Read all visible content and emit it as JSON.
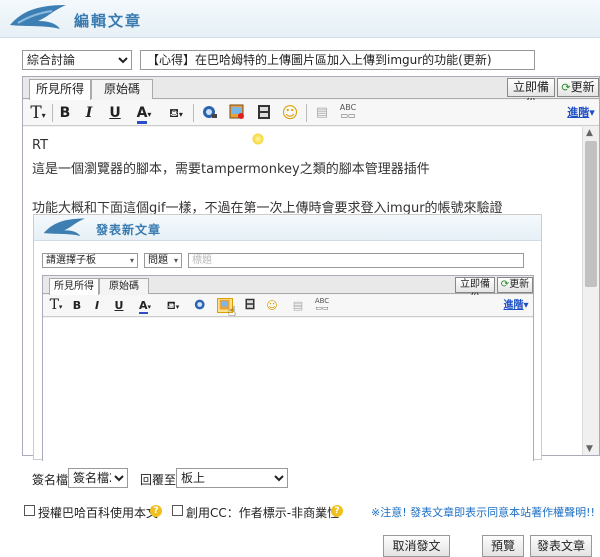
{
  "header": {
    "title": "編輯文章"
  },
  "form": {
    "category": "綜合討論",
    "title_value": "【心得】在巴哈姆特的上傳圖片區加入上傳到imgur的功能(更新)"
  },
  "editor": {
    "tabs": [
      "所見所得",
      "原始碼"
    ],
    "backup_label": "立即備份",
    "refresh_label": "更新",
    "advanced_label": "進階",
    "toolbar": {
      "font": "T",
      "bold": "B",
      "italic": "I",
      "underline": "U",
      "color": "A",
      "emoji": "☺"
    },
    "body_lines": [
      "RT",
      "這是一個瀏覽器的腳本，需要tampermonkey之類的腳本管理器插件",
      "功能大概和下面這個gif一樣，不過在第一次上傳時會要求登入imgur的帳號來驗證"
    ]
  },
  "gif": {
    "title": "發表新文章",
    "category_select": "請選擇子板",
    "type_select": "問題",
    "title_placeholder": "標題",
    "tabs": [
      "所見所得",
      "原始碼"
    ],
    "backup_label": "立即備份",
    "refresh_label": "更新",
    "advanced_label": "進階"
  },
  "footer": {
    "signature_label": "簽名檔",
    "signature_value": "簽名檔2",
    "reply_label": "回覆至",
    "reply_value": "板上",
    "license_label": "授權巴哈百科使用本文",
    "cc_label": "創用CC：作者標示-非商業性",
    "notice": "※注意! 發表文章即表示同意本站著作權聲明!!",
    "cancel_label": "取消發文",
    "preview_label": "預覽",
    "submit_label": "發表文章"
  },
  "colors": {
    "accent": "#3a7bb0",
    "notice": "#1d6fc4"
  }
}
